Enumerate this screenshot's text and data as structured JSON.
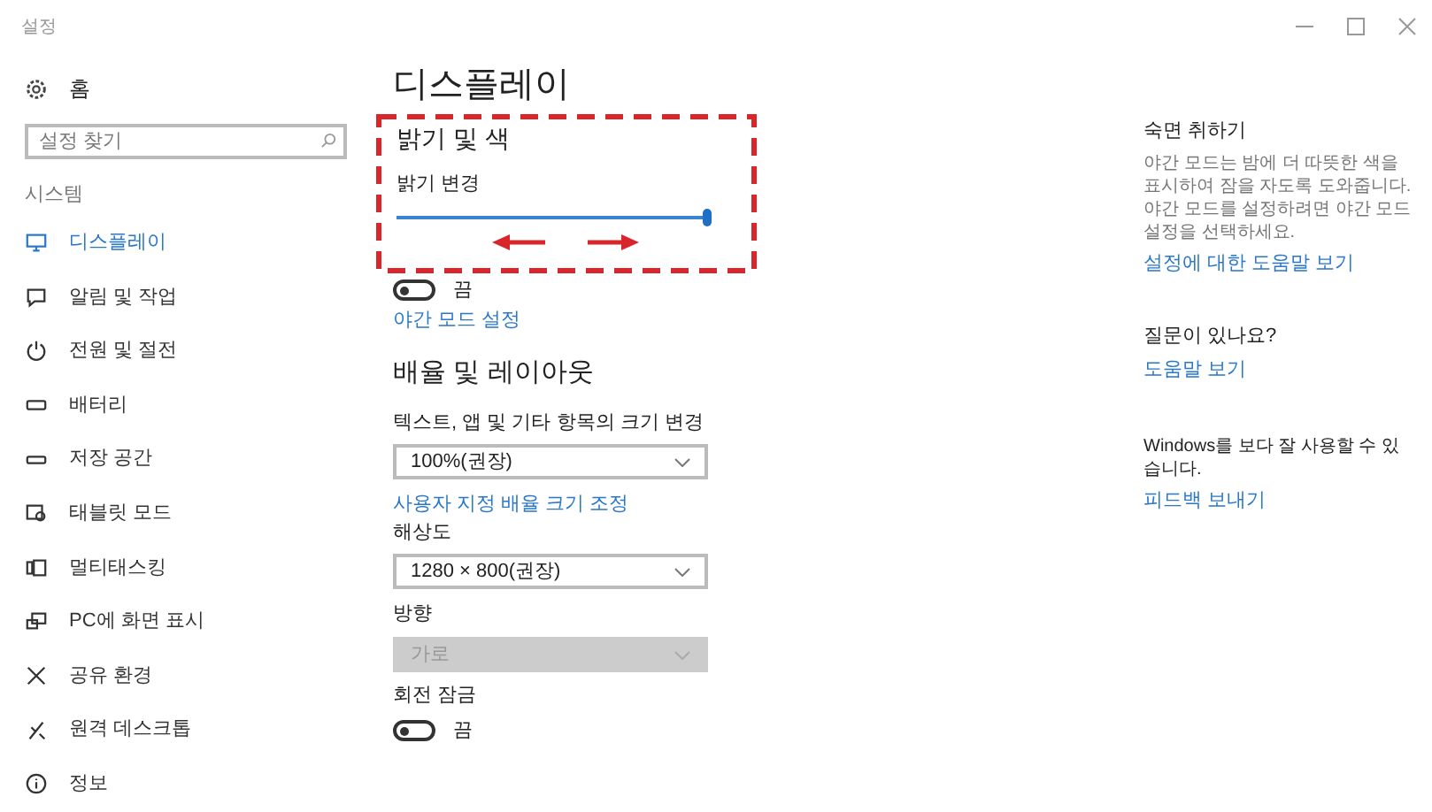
{
  "window": {
    "title": "설정"
  },
  "sidebar": {
    "home": "홈",
    "search": {
      "placeholder": "설정 찾기"
    },
    "section": "시스템",
    "items": [
      {
        "label": "디스플레이",
        "selected": true
      },
      {
        "label": "알림 및 작업",
        "selected": false
      },
      {
        "label": "전원 및 절전",
        "selected": false
      },
      {
        "label": "배터리",
        "selected": false
      },
      {
        "label": "저장 공간",
        "selected": false
      },
      {
        "label": "태블릿 모드",
        "selected": false
      },
      {
        "label": "멀티태스킹",
        "selected": false
      },
      {
        "label": "PC에 화면 표시",
        "selected": false
      },
      {
        "label": "공유 환경",
        "selected": false
      },
      {
        "label": "원격 데스크톱",
        "selected": false
      },
      {
        "label": "정보",
        "selected": false
      }
    ]
  },
  "main": {
    "title": "디스플레이",
    "brightness": {
      "heading": "밝기 및 색",
      "label": "밝기 변경",
      "level": 1.0
    },
    "items": [
      {
        "kind": "toggle",
        "on": false,
        "label": "끔"
      },
      {
        "kind": "link",
        "label": "야간 모드 설정"
      },
      {
        "kind": "heading",
        "label": "배율 및 레이아웃"
      },
      {
        "kind": "label",
        "label": "텍스트, 앱 및 기타 항목의 크기 변경"
      },
      {
        "kind": "dropdown",
        "value": "100%(권장)",
        "disabled": false
      },
      {
        "kind": "link",
        "label": "사용자 지정 배율 크기 조정"
      },
      {
        "kind": "label",
        "label": "해상도"
      },
      {
        "kind": "dropdown",
        "value": "1280 × 800(권장)",
        "disabled": false
      },
      {
        "kind": "label",
        "label": "방향"
      },
      {
        "kind": "dropdown",
        "value": "가로",
        "disabled": true
      },
      {
        "kind": "label",
        "label": "회전 잠금"
      },
      {
        "kind": "toggle",
        "on": false,
        "label": "끔"
      }
    ]
  },
  "help": [
    {
      "heading": "숙면 취하기",
      "text": "야간 모드는 밤에 더 따뜻한 색을 표시하여 잠을 자도록 도와줍니다. 야간 모드를 설정하려면 야간 모드 설정을 선택하세요.",
      "link": "설정에 대한 도움말 보기"
    },
    {
      "heading": "질문이 있나요?",
      "link": "도움말 보기"
    },
    {
      "text": "Windows를 보다 잘 사용할 수 있습니다.",
      "link": "피드백 보내기"
    }
  ]
}
